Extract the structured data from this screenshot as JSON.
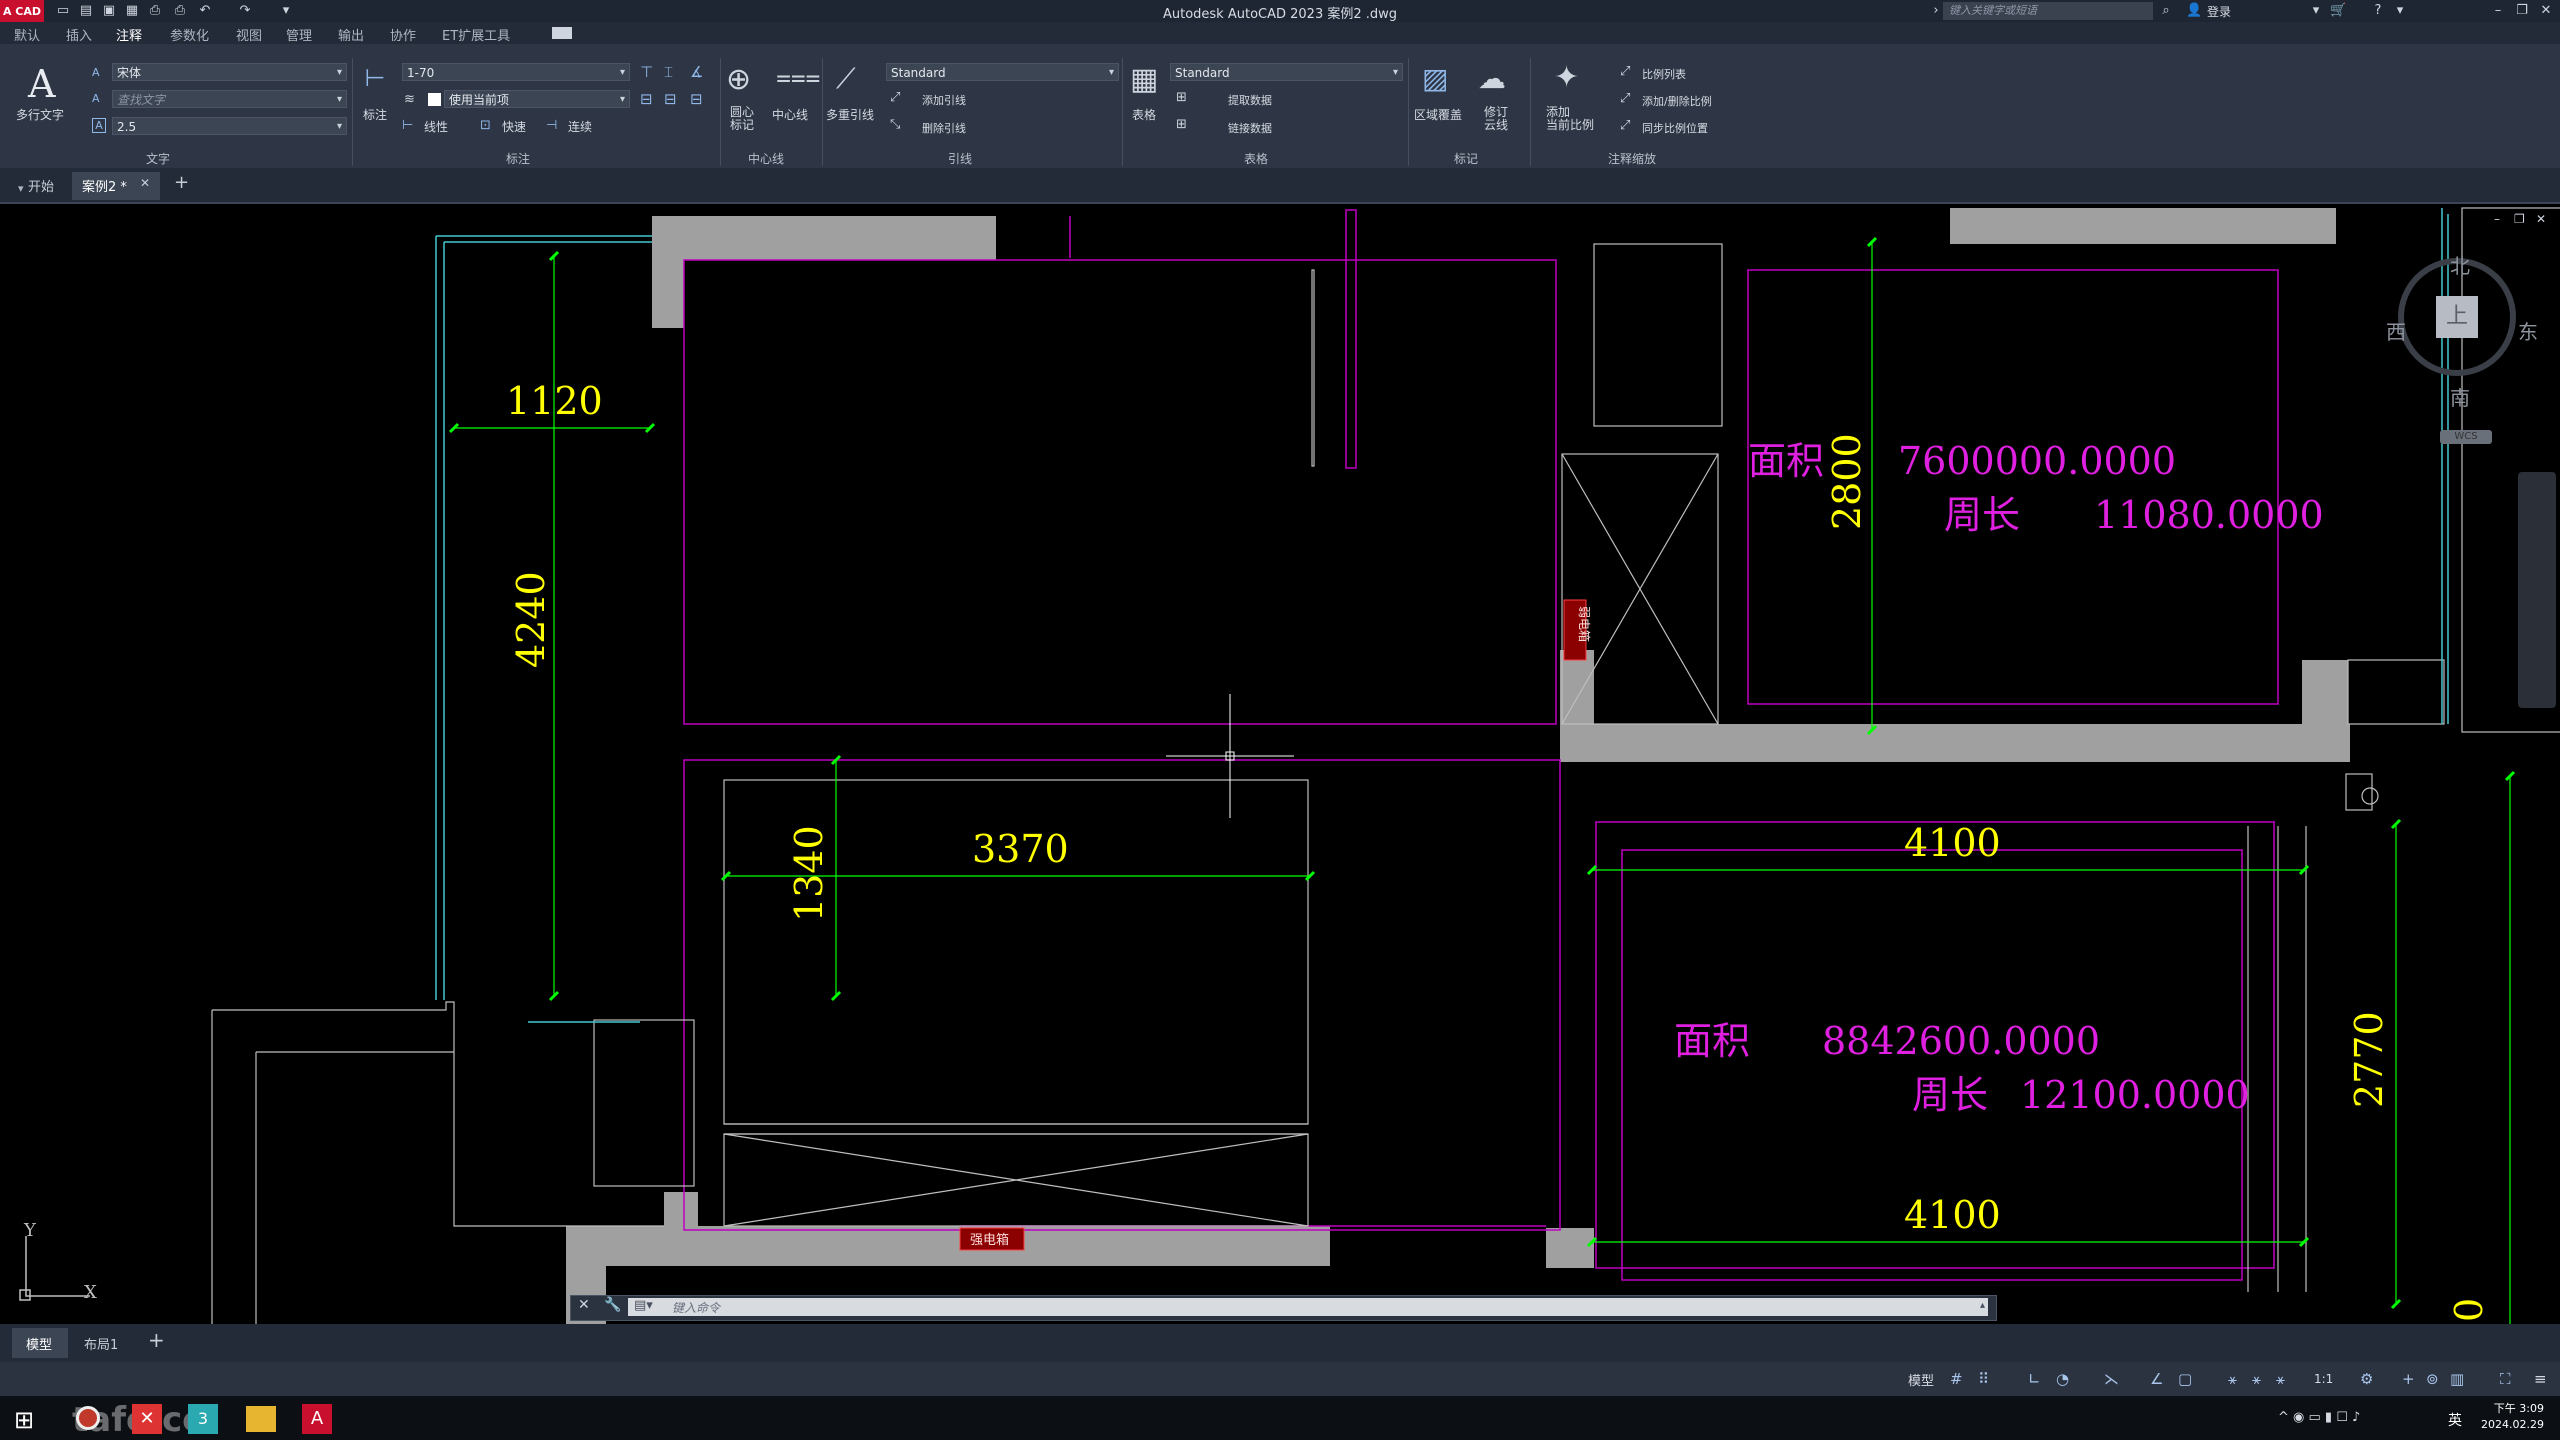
{
  "titlebar": {
    "logo": "A CAD",
    "title": "Autodesk AutoCAD 2023    案例2 .dwg",
    "search_placeholder": "键入关键字或短语",
    "login": "登录"
  },
  "menu_tabs": [
    "默认",
    "插入",
    "注释",
    "参数化",
    "视图",
    "管理",
    "输出",
    "协作",
    "ET扩展工具"
  ],
  "ribbon": {
    "text_panel": {
      "big_button": "多行文字",
      "font": "宋体",
      "find_placeholder": "查找文字",
      "height": "2.5",
      "title": "文字"
    },
    "dim_panel": {
      "big_button": "标注",
      "scale": "1-70",
      "use_current": "使用当前项",
      "linear": "线性",
      "quick": "快速",
      "continuous": "连续",
      "title": "标注"
    },
    "center_panel": {
      "center_mark": "圆心\n标记",
      "centerline": "中心线",
      "title": "中心线"
    },
    "leader_panel": {
      "multileader": "多重引线",
      "style": "Standard",
      "add_leader": "添加引线",
      "remove_leader": "删除引线",
      "title": "引线"
    },
    "table_panel": {
      "table": "表格",
      "style": "Standard",
      "extract": "提取数据",
      "link": "链接数据",
      "title": "表格"
    },
    "markup_panel": {
      "wipeout": "区域覆盖",
      "revcloud": "修订\n云线",
      "title": "标记"
    },
    "scale_panel": {
      "add_scale": "添加\n当前比例",
      "scale_list": "比例列表",
      "add_delete": "添加/删除比例",
      "sync": "同步比例位置",
      "title": "注释缩放"
    }
  },
  "doc_tabs": [
    "开始",
    "案例2 *"
  ],
  "viewcube": {
    "north": "北",
    "south": "南",
    "east": "东",
    "west": "西",
    "top": "上",
    "wcs": "WCS"
  },
  "drawing": {
    "dims": [
      "1120",
      "4240",
      "3370",
      "1340",
      "2800",
      "4100",
      "4100",
      "2770",
      "0"
    ],
    "room1": {
      "area_label": "面积",
      "area": "7600000.0000",
      "perim_label": "周长",
      "perim": "11080.0000"
    },
    "room2": {
      "area_label": "面积",
      "area": "8842600.0000",
      "perim_label": "周长",
      "perim": "12100.0000"
    },
    "box_label_1": "强电箱",
    "box_label_2": "弱电箱"
  },
  "cmdline": {
    "placeholder": "键入命令"
  },
  "layout_tabs": [
    "模型",
    "布局1"
  ],
  "status": {
    "model": "模型",
    "scale": "1:1"
  },
  "taskbar": {
    "watermark": "tafe.cc",
    "time": "下午 3:09",
    "date": "2024.02.29",
    "ime": "英"
  },
  "colors": {
    "dim": "#ffff00",
    "area_text": "#e020e0",
    "ext_line": "#00ff00",
    "wall_fill": "#a0a0a0",
    "room_outline": "#c000c0"
  }
}
